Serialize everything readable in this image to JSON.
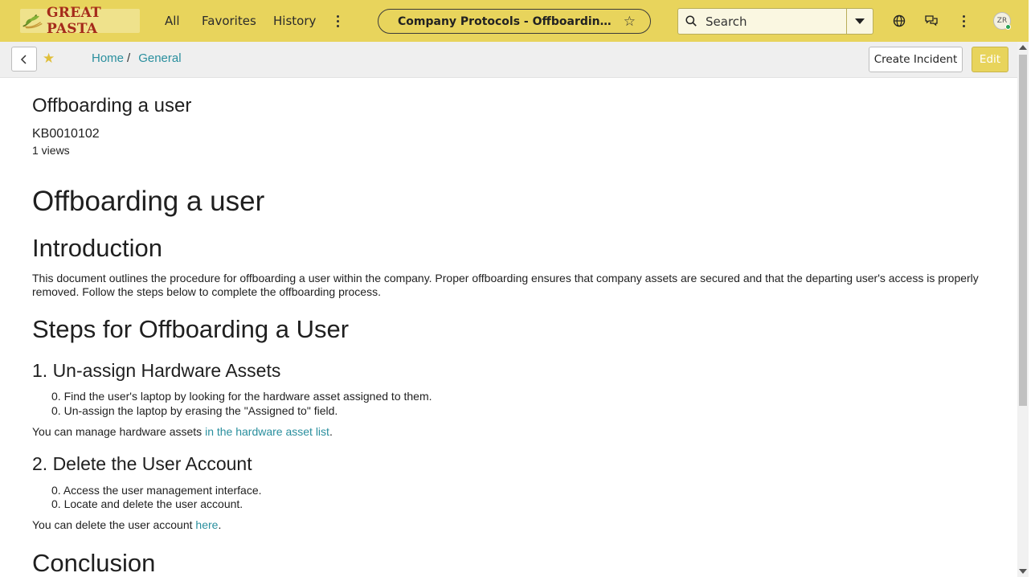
{
  "nav": {
    "logo_text": "GREAT PASTA",
    "links": [
      "All",
      "Favorites",
      "History"
    ],
    "record_title": "Company Protocols - Offboarding a user",
    "search_placeholder": "Search",
    "avatar_initials": "ZR"
  },
  "subheader": {
    "breadcrumbs": [
      "Home",
      "General"
    ],
    "breadcrumb_separator": "/",
    "create_incident_label": "Create Incident",
    "edit_label": "Edit"
  },
  "article": {
    "title": "Offboarding a user",
    "number": "KB0010102",
    "views": "1 views",
    "heading": "Offboarding a user",
    "intro_heading": "Introduction",
    "intro_text": "This document outlines the procedure for offboarding a user within the company. Proper offboarding ensures that company assets are secured and that the departing user's access is properly removed. Follow the steps below to complete the offboarding process.",
    "steps_heading": "Steps for Offboarding a User",
    "step1": {
      "heading": "1. Un-assign Hardware Assets",
      "items": [
        "Find the user's laptop by looking for the hardware asset assigned to them.",
        "Un-assign the laptop by erasing the \"Assigned to\" field."
      ],
      "note_prefix": "You can manage hardware assets ",
      "note_link": "in the hardware asset list",
      "note_suffix": "."
    },
    "step2": {
      "heading": "2. Delete the User Account",
      "items": [
        "Access the user management interface.",
        "Locate and delete the user account."
      ],
      "note_prefix": "You can delete the user account ",
      "note_link": "here",
      "note_suffix": "."
    },
    "list_marker": "0.",
    "conclusion_heading": "Conclusion"
  },
  "colors": {
    "header_bg": "#e8d45c",
    "link": "#2a8f9e",
    "edit_button": "#e8d45c",
    "logo_text": "#a52a1a"
  }
}
